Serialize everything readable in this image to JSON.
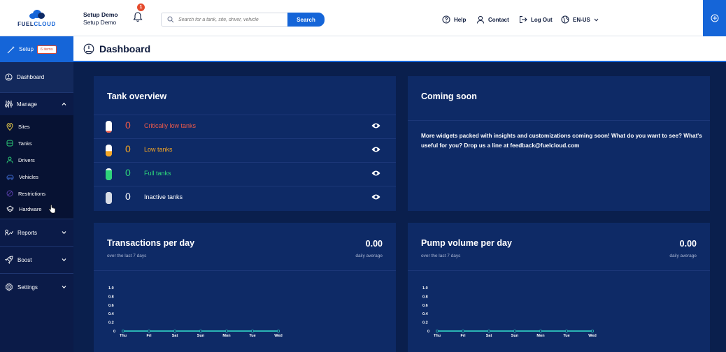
{
  "brand": {
    "name_part1": "FUEL",
    "name_part2": "CLOUD"
  },
  "account": {
    "org": "Setup Demo",
    "user": "Setup Demo"
  },
  "notifications": {
    "count": "1"
  },
  "search": {
    "placeholder": "Search for a tank, site, driver, vehicle",
    "button_label": "Search"
  },
  "header_nav": {
    "help": "Help",
    "contact": "Contact",
    "logout": "Log Out",
    "language": "EN-US"
  },
  "sidebar": {
    "setup_label": "Setup",
    "setup_badge": "6 items",
    "dashboard": "Dashboard",
    "manage": "Manage",
    "sub_items": [
      "Sites",
      "Tanks",
      "Drivers",
      "Vehicles",
      "Restrictions",
      "Hardware"
    ],
    "reports": "Reports",
    "boost": "Boost",
    "settings": "Settings"
  },
  "page": {
    "title": "Dashboard"
  },
  "tank_overview": {
    "title": "Tank overview",
    "rows": [
      {
        "count": "0",
        "label": "Critically low tanks",
        "color": "#f05a48",
        "fill": 0.15
      },
      {
        "count": "0",
        "label": "Low tanks",
        "color": "#f5a623",
        "fill": 0.45
      },
      {
        "count": "0",
        "label": "Full tanks",
        "color": "#2ed47a",
        "fill": 0.85
      },
      {
        "count": "0",
        "label": "Inactive tanks",
        "color": "#ffffff",
        "fill": 1.0
      }
    ]
  },
  "coming_soon": {
    "title": "Coming soon",
    "text": "More widgets packed with insights and customizations coming soon! What do you want to see? What's useful for you? Drop us a line at feedback@fuelcloud.com"
  },
  "colors": {
    "accent": "#1565d8",
    "navy": "#0e2a66",
    "line": "#2ec9c0",
    "badge": "#e54b2d"
  },
  "chart_data": [
    {
      "type": "line",
      "title": "Transactions per day",
      "subtitle": "over the last 7 days",
      "metric_value": "0.00",
      "metric_label": "daily average",
      "categories": [
        "Thu",
        "Fri",
        "Sat",
        "Sun",
        "Mon",
        "Tue",
        "Wed"
      ],
      "values": [
        0,
        0,
        0,
        0,
        0,
        0,
        0
      ],
      "yticks": [
        "0",
        "0.2",
        "0.4",
        "0.6",
        "0.8",
        "1.0"
      ],
      "ylim": [
        0,
        1.0
      ]
    },
    {
      "type": "line",
      "title": "Pump volume per day",
      "subtitle": "over the last 7 days",
      "metric_value": "0.00",
      "metric_label": "daily average",
      "categories": [
        "Thu",
        "Fri",
        "Sat",
        "Sun",
        "Mon",
        "Tue",
        "Wed"
      ],
      "values": [
        0,
        0,
        0,
        0,
        0,
        0,
        0
      ],
      "yticks": [
        "0",
        "0.2",
        "0.4",
        "0.6",
        "0.8",
        "1.0"
      ],
      "ylim": [
        0,
        1.0
      ]
    }
  ]
}
